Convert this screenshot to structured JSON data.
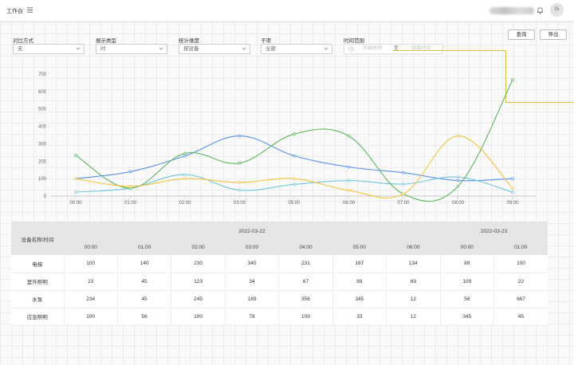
{
  "header": {
    "title": "工作台",
    "avatar_text": "Gi"
  },
  "toolbar": {
    "query_label": "查询",
    "export_label": "导出"
  },
  "filters": [
    {
      "label": "对比方式",
      "value": "无"
    },
    {
      "label": "展示类型",
      "value": "时"
    },
    {
      "label": "统计维度",
      "value": "按设备"
    },
    {
      "label": "子项",
      "value": "全部"
    }
  ],
  "time_range": {
    "label": "时间范围",
    "start_placeholder": "开始时间",
    "separator": "至",
    "end_placeholder": "结束时间"
  },
  "colors": {
    "電梯": "#5b8ff0",
    "室外照明": "#6ec6d9",
    "水泵": "#5cb85c",
    "应急照明": "#f5c242",
    "accent_line": "#d4c04a"
  },
  "chart_data": {
    "type": "line",
    "x": [
      "00:00",
      "01:00",
      "02:00",
      "03:00",
      "05:00",
      "06:00",
      "07:00",
      "08:00",
      "09:00"
    ],
    "ylim": [
      0,
      700
    ],
    "yticks": [
      "0",
      "100",
      "200",
      "300",
      "400",
      "500",
      "600",
      "700"
    ],
    "smooth": true,
    "grid": false,
    "series": [
      {
        "key": "电梯",
        "color": "#5b8ff0",
        "values": [
          100,
          140,
          230,
          345,
          231,
          167,
          134,
          89,
          100
        ]
      },
      {
        "key": "室外照明",
        "color": "#6ec6d9",
        "values": [
          23,
          45,
          123,
          34,
          67,
          89,
          69,
          109,
          22
        ]
      },
      {
        "key": "水泵",
        "color": "#5cb85c",
        "values": [
          234,
          45,
          245,
          189,
          356,
          345,
          12,
          56,
          667
        ]
      },
      {
        "key": "应急照明",
        "color": "#f5c242",
        "values": [
          100,
          56,
          100,
          78,
          100,
          33,
          12,
          345,
          45
        ]
      }
    ]
  },
  "table": {
    "corner_header": "设备名称/时间",
    "date_groups": [
      {
        "date": "2022-03-22",
        "span": 7
      },
      {
        "date": "2022-03-23",
        "span": 2
      }
    ],
    "hours": [
      "00:00",
      "01:00",
      "02:00",
      "03:00",
      "04:00",
      "05:00",
      "06:00",
      "00:00",
      "01:00"
    ],
    "rows": [
      {
        "name": "电梯",
        "values": [
          "100",
          "140",
          "230",
          "345",
          "231",
          "167",
          "134",
          "89",
          "100"
        ]
      },
      {
        "name": "室外照明",
        "values": [
          "23",
          "45",
          "123",
          "34",
          "67",
          "89",
          "69",
          "109",
          "22"
        ]
      },
      {
        "name": "水泵",
        "values": [
          "234",
          "45",
          "245",
          "189",
          "356",
          "345",
          "12",
          "56",
          "667"
        ]
      },
      {
        "name": "应急照明",
        "values": [
          "100",
          "56",
          "100",
          "78",
          "100",
          "33",
          "12",
          "345",
          "45"
        ]
      }
    ]
  }
}
